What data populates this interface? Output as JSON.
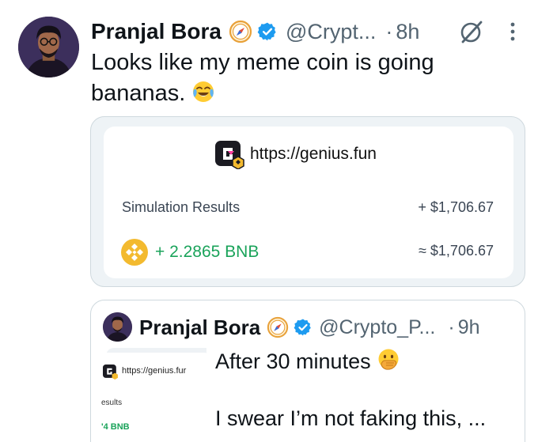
{
  "tweet": {
    "author_name": "Pranjal Bora",
    "handle": "@Crypt...",
    "separator": "·",
    "time": "8h",
    "text": "Looks like my meme coin is going bananas.",
    "emoji": "face-with-tears-of-joy"
  },
  "card": {
    "url": "https://genius.fun",
    "sim_label": "Simulation Results",
    "sim_value": "+ $1,706.67",
    "bnb_amount": "+ 2.2865 BNB",
    "approx_value": "≈ $1,706.67"
  },
  "quote": {
    "author_name": "Pranjal Bora",
    "handle": "@Crypto_P...",
    "separator": "·",
    "time": "9h",
    "line1": "After 30 minutes",
    "line1_emoji": "face-with-open-eyes-and-hand-over-mouth",
    "line2": "I swear I’m not faking this, ...",
    "thumb": {
      "url": "https://genius.fur",
      "results": "esults",
      "bnb": "'4 BNB"
    }
  },
  "colors": {
    "verified": "#1d9bf0",
    "bnb_green": "#1aa35a",
    "bnb_gold": "#f3ba2f",
    "muted": "#536471"
  }
}
